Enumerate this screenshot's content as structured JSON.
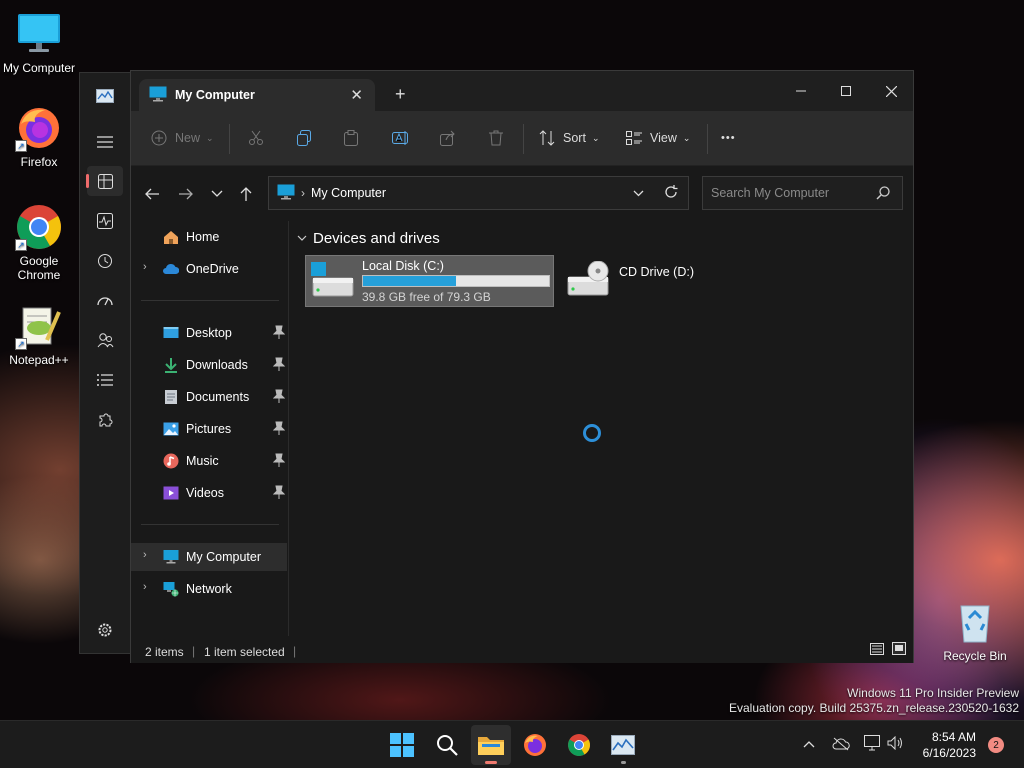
{
  "desktop": {
    "icons": [
      {
        "label": "My Computer"
      },
      {
        "label": "Firefox"
      },
      {
        "label": "Google Chrome"
      },
      {
        "label": "Notepad++"
      },
      {
        "label": "Recycle Bin"
      }
    ],
    "watermark": {
      "line1": "Windows 11 Pro Insider Preview",
      "line2": "Evaluation copy. Build 25375.zn_release.230520-1632"
    }
  },
  "explorer": {
    "tab_title": "My Computer",
    "toolbar": {
      "new_label": "New",
      "sort_label": "Sort",
      "view_label": "View",
      "more_label": "•••"
    },
    "address": {
      "crumb": "My Computer",
      "search_placeholder": "Search My Computer"
    },
    "nav": {
      "home": "Home",
      "onedrive": "OneDrive",
      "desktop": "Desktop",
      "downloads": "Downloads",
      "documents": "Documents",
      "pictures": "Pictures",
      "music": "Music",
      "videos": "Videos",
      "mycomputer": "My Computer",
      "network": "Network"
    },
    "content": {
      "group_header": "Devices and drives",
      "drives": [
        {
          "name": "Local Disk (C:)",
          "free_text": "39.8 GB free of 79.3 GB",
          "used_fraction": 0.498
        },
        {
          "name": "CD Drive (D:)"
        }
      ]
    },
    "status": {
      "items": "2 items",
      "selected": "1 item selected"
    }
  },
  "taskbar": {
    "time": "8:54 AM",
    "date": "6/16/2023",
    "notification_count": "2"
  },
  "colors": {
    "accent": "#26a0da",
    "tab_indicator": "#ef7a6f"
  }
}
